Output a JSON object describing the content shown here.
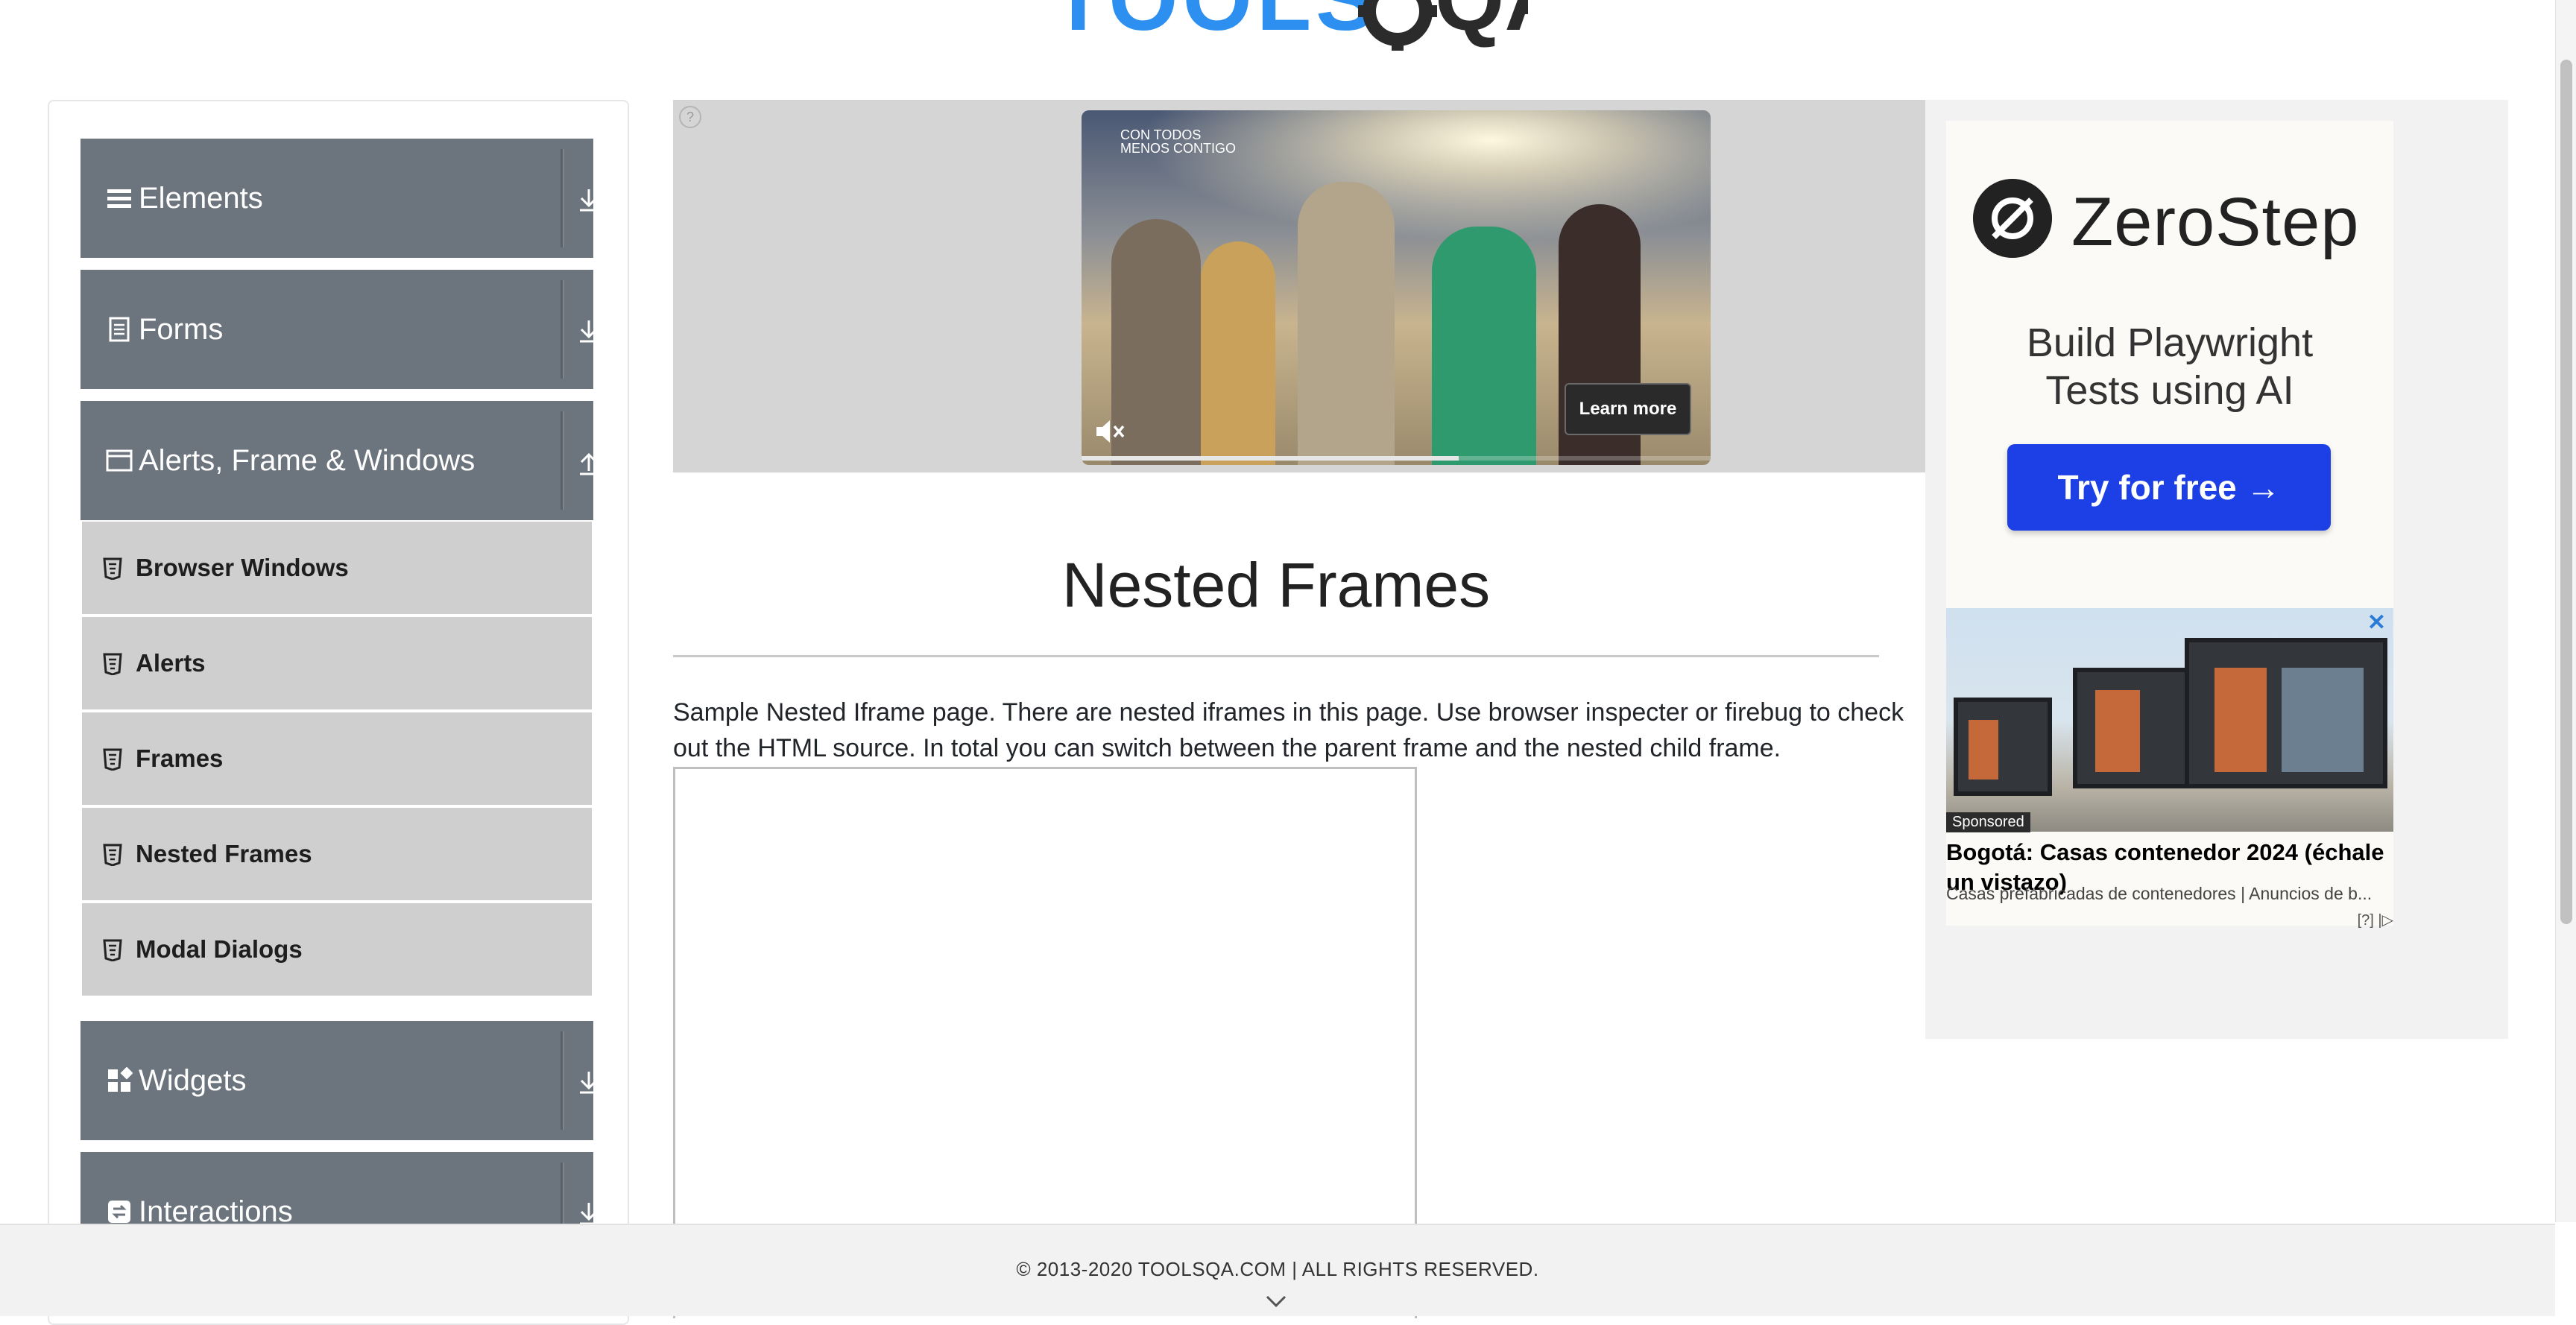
{
  "header": {
    "logo_left": "TOOLS",
    "logo_right": "QA"
  },
  "sidebar": {
    "groups": [
      {
        "label": "Elements",
        "icon": "list-icon",
        "arrow": "download-icon"
      },
      {
        "label": "Forms",
        "icon": "document-icon",
        "arrow": "download-icon"
      },
      {
        "label": "Alerts, Frame & Windows",
        "icon": "window-icon",
        "arrow": "upload-icon"
      },
      {
        "label": "Widgets",
        "icon": "widgets-icon",
        "arrow": "download-icon"
      },
      {
        "label": "Interactions",
        "icon": "interactions-icon",
        "arrow": "download-icon"
      }
    ],
    "sub_items": [
      {
        "label": "Browser Windows",
        "icon": "html5-icon"
      },
      {
        "label": "Alerts",
        "icon": "html5-icon"
      },
      {
        "label": "Frames",
        "icon": "html5-icon"
      },
      {
        "label": "Nested Frames",
        "icon": "html5-icon"
      },
      {
        "label": "Modal Dialogs",
        "icon": "html5-icon"
      }
    ]
  },
  "top_ad": {
    "info_label": "?",
    "video_caption_line1": "CON TODOS",
    "video_caption_line2": "MENOS CONTIGO",
    "learn_more": "Learn more",
    "progress": 0.6
  },
  "main": {
    "title": "Nested Frames",
    "description": "Sample Nested Iframe page. There are nested iframes in this page. Use browser inspecter or firebug to check out the HTML source. In total you can switch between the parent frame and the nested child frame."
  },
  "right_ad": {
    "brand": "ZeroStep",
    "tagline_line1": "Build Playwright",
    "tagline_line2": "Tests using AI",
    "button": "Try for free →",
    "close": "✕",
    "sponsored": "Sponsored",
    "ad_title": "Bogotá: Casas contenedor 2024 (échale un vistazo)",
    "ad_subtitle": "Casas prefabricadas de contenedores | Anuncios de b...",
    "ad_choices": "[?] |▷"
  },
  "footer": {
    "copyright": "© 2013-2020 TOOLSQA.COM | ALL RIGHTS RESERVED."
  },
  "colors": {
    "sidebar_group": "#6c757d",
    "sidebar_sub": "#cfcfcf",
    "ad_button": "#1d40e6"
  }
}
